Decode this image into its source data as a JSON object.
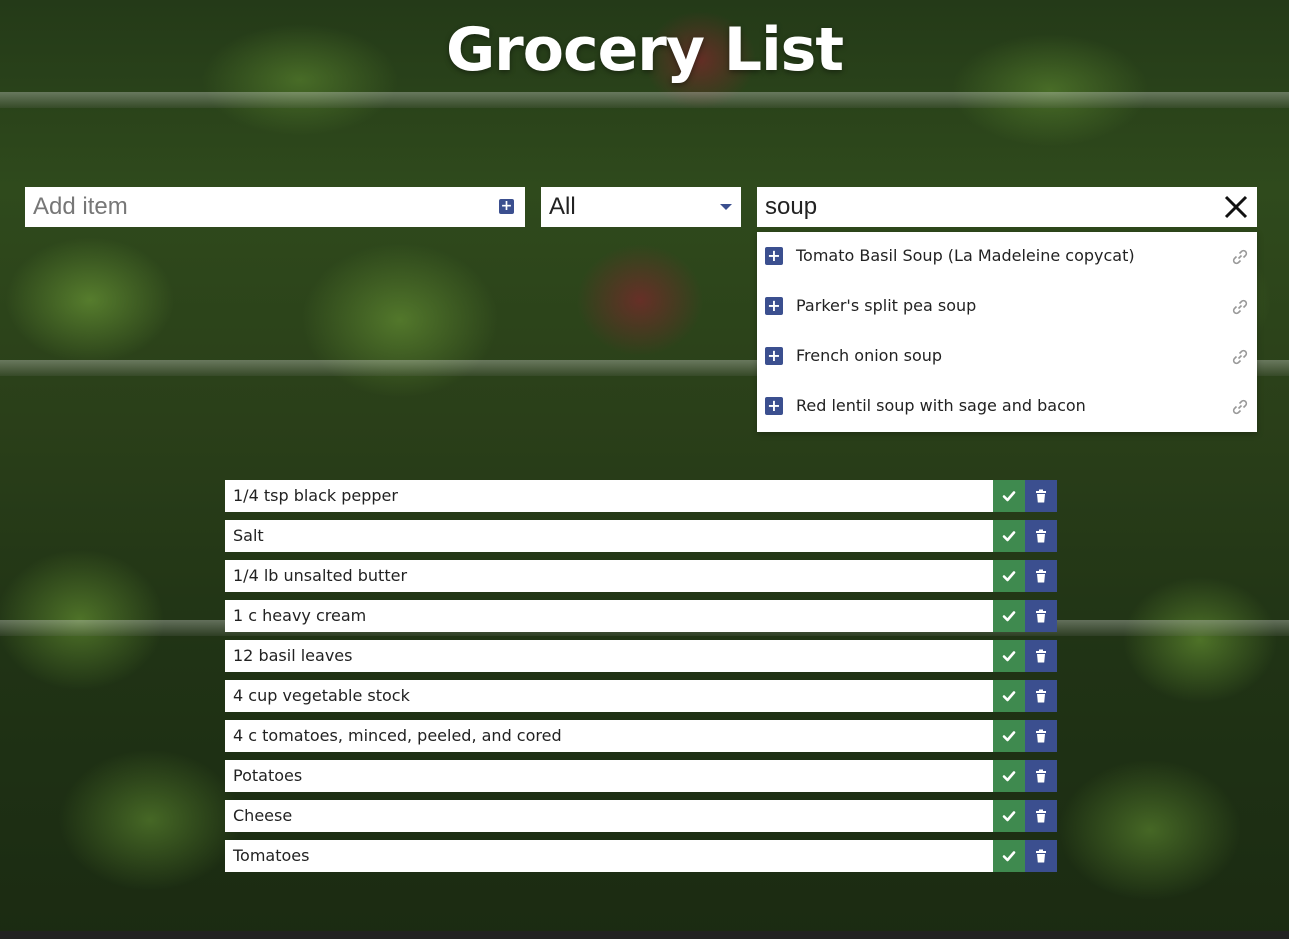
{
  "app": {
    "title": "Grocery List"
  },
  "add_item": {
    "placeholder": "Add item",
    "add_icon": "plus-square-icon"
  },
  "filter": {
    "selected": "All"
  },
  "search": {
    "value": "soup",
    "clear_icon": "close-icon"
  },
  "suggestions": [
    {
      "label": "Tomato Basil Soup (La Madeleine copycat)",
      "add_icon": "plus-square-icon",
      "link_icon": "link-icon"
    },
    {
      "label": "Parker's split pea soup",
      "add_icon": "plus-square-icon",
      "link_icon": "link-icon"
    },
    {
      "label": "French onion soup",
      "add_icon": "plus-square-icon",
      "link_icon": "link-icon"
    },
    {
      "label": "Red lentil soup with sage and bacon",
      "add_icon": "plus-square-icon",
      "link_icon": "link-icon"
    }
  ],
  "items": [
    {
      "label": "1/4 tsp black pepper"
    },
    {
      "label": "Salt"
    },
    {
      "label": "1/4 lb unsalted butter"
    },
    {
      "label": "1 c heavy cream"
    },
    {
      "label": "12 basil leaves"
    },
    {
      "label": "4 cup vegetable stock"
    },
    {
      "label": "4 c tomatoes, minced, peeled, and cored"
    },
    {
      "label": "Potatoes"
    },
    {
      "label": "Cheese"
    },
    {
      "label": "Tomatoes"
    }
  ],
  "colors": {
    "accent": "#3b4f8f",
    "done": "#3f8a4f",
    "title": "#ffffff"
  }
}
